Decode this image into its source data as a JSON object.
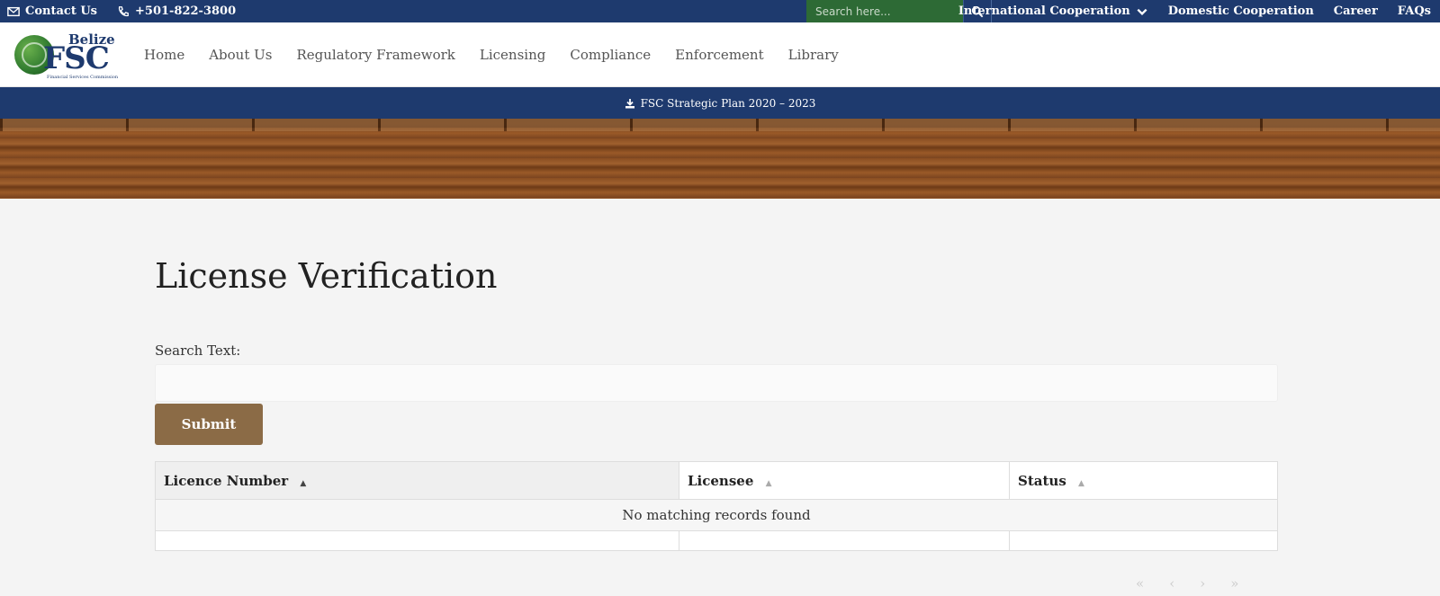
{
  "topbar": {
    "contact_label": "Contact Us",
    "phone_label": "+501-822-3800",
    "search_placeholder": "Search here...",
    "right_links": [
      "International Cooperation",
      "Domestic Cooperation",
      "Career",
      "FAQs"
    ]
  },
  "logo": {
    "top_text": "Belize",
    "main_text": "FSC",
    "sub_text": "Financial Services Commission"
  },
  "nav": {
    "links": [
      "Home",
      "About Us",
      "Regulatory Framework",
      "Licensing",
      "Compliance",
      "Enforcement",
      "Library"
    ]
  },
  "banner": {
    "download_label": "FSC Strategic Plan 2020 – 2023"
  },
  "main": {
    "title": "License Verification",
    "search_label": "Search Text:",
    "search_value": "",
    "submit_label": "Submit",
    "table": {
      "columns": [
        "Licence Number",
        "Licensee",
        "Status"
      ],
      "empty_message": "No matching records found"
    },
    "pager": [
      "«",
      "‹",
      "›",
      "»"
    ]
  },
  "colors": {
    "navy": "#1e3a6e",
    "search_green": "#2d6a35",
    "submit_brown": "#8b6b46"
  }
}
